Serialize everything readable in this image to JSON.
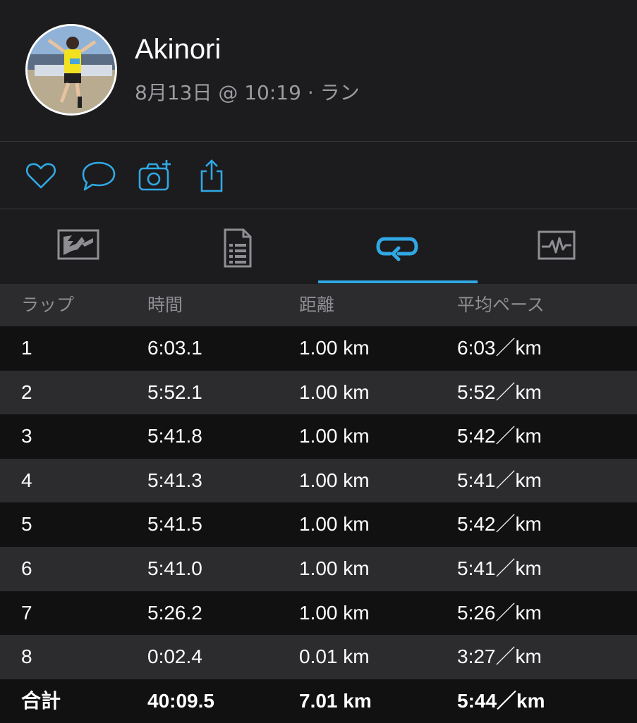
{
  "profile": {
    "name": "Akinori",
    "meta": "8月13日 @ 10:19 · ラン"
  },
  "actions": [
    "heart-icon",
    "comment-icon",
    "camera-add-icon",
    "share-icon"
  ],
  "tabs": [
    "map-icon",
    "details-icon",
    "laps-icon",
    "chart-icon"
  ],
  "active_tab": 2,
  "colors": {
    "accent": "#31a8e4",
    "background": "#1c1c1e",
    "row_dark": "#111112",
    "row_light": "#2c2c2e",
    "muted_text": "#8e8e93"
  },
  "table": {
    "headers": [
      "ラップ",
      "時間",
      "距離",
      "平均ペース"
    ],
    "rows": [
      [
        "1",
        "6:03.1",
        "1.00 km",
        "6:03／km"
      ],
      [
        "2",
        "5:52.1",
        "1.00 km",
        "5:52／km"
      ],
      [
        "3",
        "5:41.8",
        "1.00 km",
        "5:42／km"
      ],
      [
        "4",
        "5:41.3",
        "1.00 km",
        "5:41／km"
      ],
      [
        "5",
        "5:41.5",
        "1.00 km",
        "5:42／km"
      ],
      [
        "6",
        "5:41.0",
        "1.00 km",
        "5:41／km"
      ],
      [
        "7",
        "5:26.2",
        "1.00 km",
        "5:26／km"
      ],
      [
        "8",
        "0:02.4",
        "0.01 km",
        "3:27／km"
      ]
    ],
    "total": [
      "合計",
      "40:09.5",
      "7.01 km",
      "5:44／km"
    ]
  }
}
